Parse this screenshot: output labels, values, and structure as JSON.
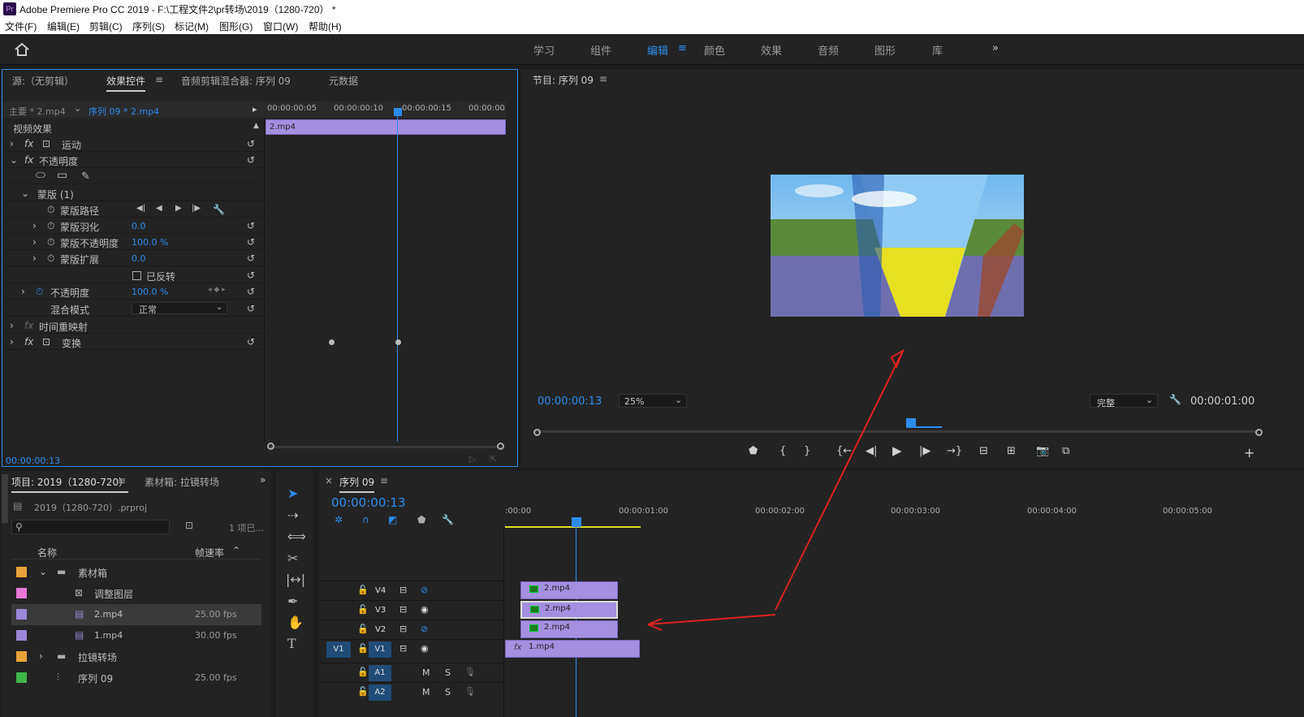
{
  "app": {
    "title": "Adobe Premiere Pro CC 2019 - F:\\工程文件2\\pr转场\\2019（1280-720） *",
    "icon": "Pr"
  },
  "menu": [
    "文件(F)",
    "编辑(E)",
    "剪辑(C)",
    "序列(S)",
    "标记(M)",
    "图形(G)",
    "窗口(W)",
    "帮助(H)"
  ],
  "workspaces": [
    "学习",
    "组件",
    "编辑",
    "颜色",
    "效果",
    "音频",
    "图形",
    "库"
  ],
  "active_workspace": "编辑",
  "effect_panel": {
    "tabs": [
      "源:（无剪辑）",
      "效果控件",
      "音频剪辑混合器: 序列 09",
      "元数据"
    ],
    "master": "主要 * 2.mp4",
    "sequence": "序列 09 * 2.mp4",
    "ruler": [
      "00:00:00:05",
      "00:00:00:10",
      "00:00:00:15",
      "00:00:00"
    ],
    "clip_name": "2.mp4",
    "section": "视频效果",
    "motion": "运动",
    "opacity": "不透明度",
    "mask": "蒙版 (1)",
    "mask_path": "蒙版路径",
    "mask_feather": "蒙版羽化",
    "mask_feather_val": "0.0",
    "mask_opacity": "蒙版不透明度",
    "mask_opacity_val": "100.0 %",
    "mask_expand": "蒙版扩展",
    "mask_expand_val": "0.0",
    "inverted": "已反转",
    "opacity2": "不透明度",
    "opacity2_val": "100.0 %",
    "blend": "混合模式",
    "blend_val": "正常",
    "time_remap": "时间重映射",
    "transform": "变换",
    "timecode": "00:00:00:13"
  },
  "program": {
    "title": "节目: 序列 09",
    "timecode": "00:00:00:13",
    "zoom": "25%",
    "quality": "完整",
    "duration": "00:00:01:00"
  },
  "project": {
    "tabs": [
      "项目: 2019（1280-720）",
      "素材箱: 拉镜转场"
    ],
    "file": "2019（1280-720）.prproj",
    "count": "1 项已...",
    "col_name": "名称",
    "col_fps": "帧速率",
    "items": [
      {
        "name": "素材箱",
        "fps": "",
        "color": "#e8a23a"
      },
      {
        "name": "调整图层",
        "fps": "",
        "color": "#e877d8"
      },
      {
        "name": "2.mp4",
        "fps": "25.00 fps",
        "color": "#9b87d8"
      },
      {
        "name": "1.mp4",
        "fps": "30.00 fps",
        "color": "#9b87d8"
      },
      {
        "name": "拉镜转场",
        "fps": "",
        "color": "#e8a23a"
      },
      {
        "name": "序列 09",
        "fps": "25.00 fps",
        "color": "#3fb54a"
      }
    ]
  },
  "timeline": {
    "tab": "序列 09",
    "timecode": "00:00:00:13",
    "ruler": [
      ":00:00",
      "00:00:01:00",
      "00:00:02:00",
      "00:00:03:00",
      "00:00:04:00",
      "00:00:05:00"
    ],
    "tracks": [
      "V4",
      "V3",
      "V2",
      "V1",
      "A1",
      "A2"
    ],
    "src_track": "V1",
    "clips": [
      "2.mp4",
      "2.mp4",
      "2.mp4",
      "1.mp4"
    ],
    "m": "M",
    "s": "S"
  },
  "colors": {
    "accent": "#2d8ceb",
    "clip": "#a48fe0",
    "arrow": "#e02020"
  }
}
